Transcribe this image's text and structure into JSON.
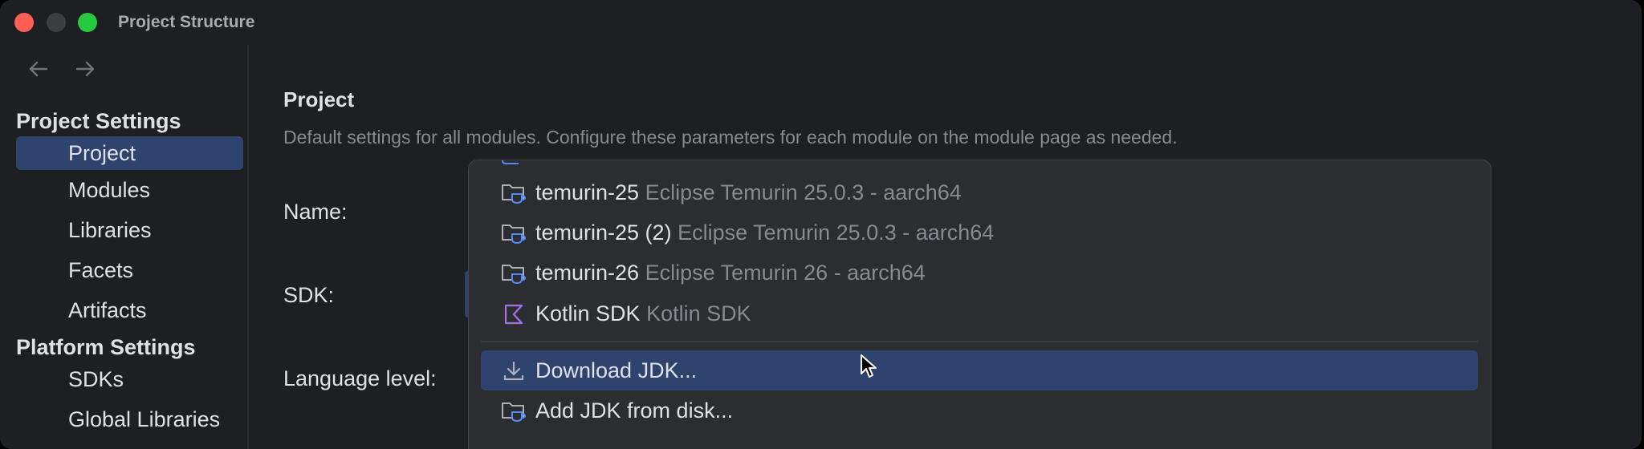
{
  "window": {
    "title": "Project Structure",
    "colors": {
      "background": "#1e1f22",
      "selection": "#2e436e",
      "popup": "#2b2d30",
      "text": "#dfe1e5",
      "muted": "#868a91"
    }
  },
  "sidebar": {
    "back_icon": "arrow-left-icon",
    "forward_icon": "arrow-right-icon",
    "project_settings_header": "Project Settings",
    "project_settings_items": [
      {
        "label": "Project",
        "selected": true
      },
      {
        "label": "Modules"
      },
      {
        "label": "Libraries"
      },
      {
        "label": "Facets"
      },
      {
        "label": "Artifacts"
      }
    ],
    "platform_settings_header": "Platform Settings",
    "platform_settings_items": [
      {
        "label": "SDKs"
      },
      {
        "label": "Global Libraries"
      }
    ]
  },
  "content": {
    "title": "Project",
    "description": "Default settings for all modules. Configure these parameters for each module on the module page as needed.",
    "name_label": "Name:",
    "sdk_label": "SDK:",
    "language_level_label": "Language level:"
  },
  "sdk_popup": {
    "items": [
      {
        "icon": "jdk-folder-icon",
        "name": "temurin-25",
        "detail": "Eclipse Temurin 25.0.3 - aarch64"
      },
      {
        "icon": "jdk-folder-icon",
        "name": "temurin-25 (2)",
        "detail": "Eclipse Temurin 25.0.3 - aarch64"
      },
      {
        "icon": "jdk-folder-icon",
        "name": "temurin-26",
        "detail": "Eclipse Temurin 26 - aarch64"
      },
      {
        "icon": "kotlin-icon",
        "name": "Kotlin SDK",
        "detail": "Kotlin SDK"
      }
    ],
    "actions": [
      {
        "icon": "download-icon",
        "label": "Download JDK...",
        "highlighted": true
      },
      {
        "icon": "jdk-folder-icon",
        "label": "Add JDK from disk..."
      }
    ]
  }
}
